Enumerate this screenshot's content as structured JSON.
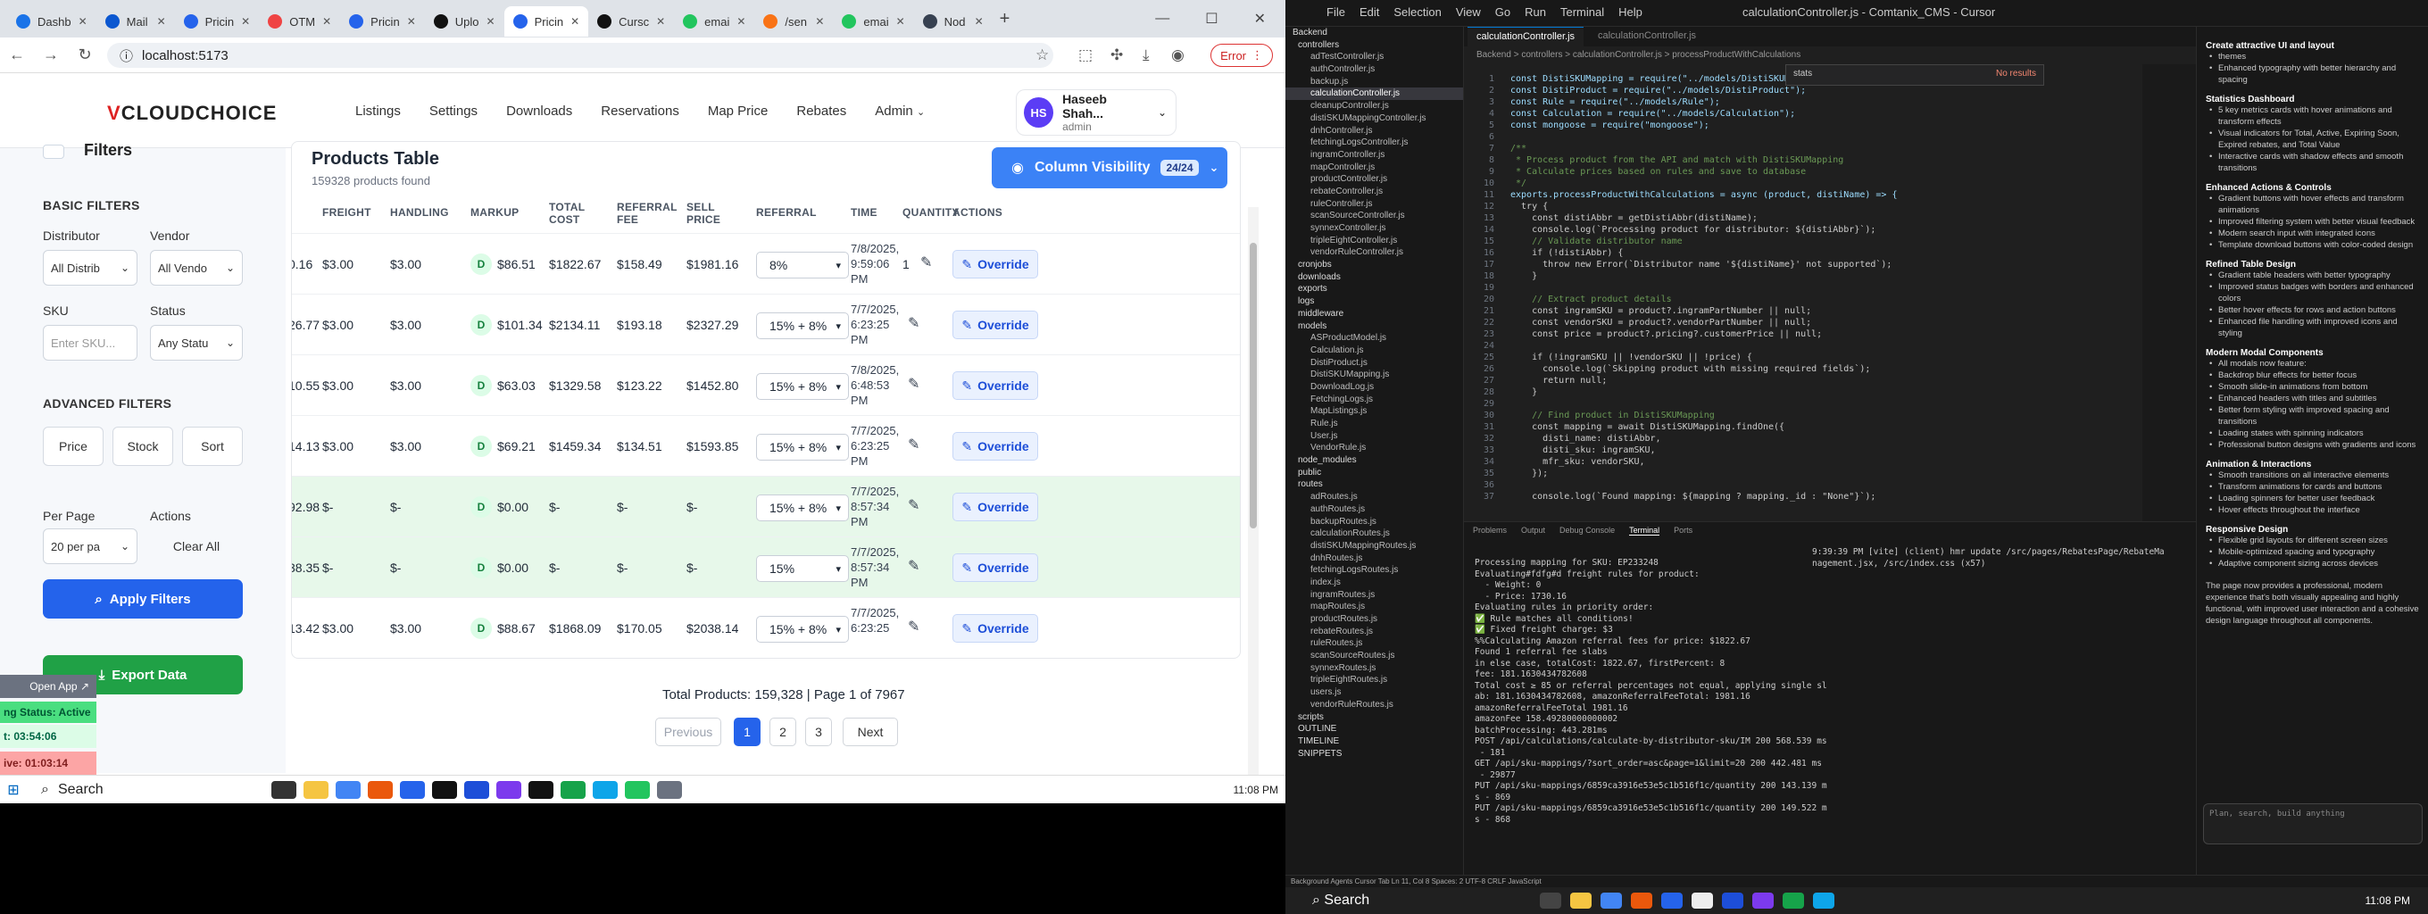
{
  "browser": {
    "tabs": [
      {
        "label": "Dashb",
        "color": "#1a73e8"
      },
      {
        "label": "Mail",
        "color": "#0b57d0"
      },
      {
        "label": "Pricin",
        "color": "#2563eb"
      },
      {
        "label": "OTM",
        "color": "#ef4444"
      },
      {
        "label": "Pricin",
        "color": "#2563eb"
      },
      {
        "label": "Uplo",
        "color": "#111111"
      },
      {
        "label": "Pricin",
        "color": "#2563eb"
      },
      {
        "label": "Cursc",
        "color": "#111111"
      },
      {
        "label": "emai",
        "color": "#22c55e"
      },
      {
        "label": "/sen",
        "color": "#f97316"
      },
      {
        "label": "emai",
        "color": "#22c55e"
      },
      {
        "label": "Nod",
        "color": "#374151"
      }
    ],
    "url": "localhost:5173",
    "error_label": "Error"
  },
  "header": {
    "logo_v": "V",
    "logo_rest": "CLOUDCHOICE",
    "menu": [
      "Listings",
      "Settings",
      "Downloads",
      "Reservations",
      "Map Price",
      "Rebates",
      "Admin"
    ],
    "user": {
      "initials": "HS",
      "name": "Haseeb Shah...",
      "role": "admin"
    }
  },
  "sidebar": {
    "title": "Filters",
    "basic": "BASIC FILTERS",
    "distributor_label": "Distributor",
    "distributor_value": "All Distrib",
    "vendor_label": "Vendor",
    "vendor_value": "All Vendo",
    "sku_label": "SKU",
    "sku_placeholder": "Enter SKU...",
    "status_label": "Status",
    "status_value": "Any Statu",
    "advanced": "ADVANCED FILTERS",
    "adv_buttons": [
      "Price",
      "Stock",
      "Sort"
    ],
    "per_page_label": "Per Page",
    "per_page_value": "20 per pa",
    "actions_label": "Actions",
    "clear_all": "Clear All",
    "apply": "Apply Filters",
    "export": "Export Data"
  },
  "overlay": {
    "open_app": "Open App",
    "status": "ng Status: Active",
    "timer1": "t: 03:54:06",
    "timer2": "ive: 01:03:14"
  },
  "table": {
    "title": "Products Table",
    "subtitle": "159328 products found",
    "column_visibility": "Column Visibility",
    "col_count": "24/24",
    "headers": [
      "FREIGHT",
      "HANDLING",
      "MARKUP",
      "TOTAL COST",
      "REFERRAL FEE",
      "SELL PRICE",
      "REFERRAL",
      "TIME",
      "QUANTITY",
      "ACTIONS"
    ],
    "rows": [
      {
        "partial": "0.16",
        "freight": "$3.00",
        "handling": "$3.00",
        "markup": "$86.51",
        "total": "$1822.67",
        "ref_fee": "$158.49",
        "sell": "$1981.16",
        "referral": "8%",
        "time": [
          "7/8/2025,",
          "9:59:06",
          "PM"
        ],
        "qty": "1",
        "green": false
      },
      {
        "partial": "26.77",
        "freight": "$3.00",
        "handling": "$3.00",
        "markup": "$101.34",
        "total": "$2134.11",
        "ref_fee": "$193.18",
        "sell": "$2327.29",
        "referral": "15% + 8%",
        "time": [
          "7/7/2025,",
          "6:23:25",
          "PM"
        ],
        "qty": "",
        "green": false
      },
      {
        "partial": "10.55",
        "freight": "$3.00",
        "handling": "$3.00",
        "markup": "$63.03",
        "total": "$1329.58",
        "ref_fee": "$123.22",
        "sell": "$1452.80",
        "referral": "15% + 8%",
        "time": [
          "7/8/2025,",
          "6:48:53",
          "PM"
        ],
        "qty": "",
        "green": false
      },
      {
        "partial": "14.13",
        "freight": "$3.00",
        "handling": "$3.00",
        "markup": "$69.21",
        "total": "$1459.34",
        "ref_fee": "$134.51",
        "sell": "$1593.85",
        "referral": "15% + 8%",
        "time": [
          "7/7/2025,",
          "6:23:25",
          "PM"
        ],
        "qty": "",
        "green": false
      },
      {
        "partial": "92.98",
        "freight": "$-",
        "handling": "$-",
        "markup": "$0.00",
        "total": "$-",
        "ref_fee": "$-",
        "sell": "$-",
        "referral": "15% + 8%",
        "time": [
          "7/7/2025,",
          "8:57:34",
          "PM"
        ],
        "qty": "",
        "green": true
      },
      {
        "partial": "38.35",
        "freight": "$-",
        "handling": "$-",
        "markup": "$0.00",
        "total": "$-",
        "ref_fee": "$-",
        "sell": "$-",
        "referral": "15%",
        "time": [
          "7/7/2025,",
          "8:57:34",
          "PM"
        ],
        "qty": "",
        "green": true
      },
      {
        "partial": "13.42",
        "freight": "$3.00",
        "handling": "$3.00",
        "markup": "$88.67",
        "total": "$1868.09",
        "ref_fee": "$170.05",
        "sell": "$2038.14",
        "referral": "15% + 8%",
        "time": [
          "7/7/2025,",
          "6:23:25",
          ""
        ],
        "qty": "",
        "green": false
      }
    ],
    "badge": "D",
    "override": "Override"
  },
  "pagination": {
    "total": "Total Products: 159,328 | Page 1 of 7967",
    "prev": "Previous",
    "pages": [
      "1",
      "2",
      "3"
    ],
    "next": "Next"
  },
  "taskbar": {
    "search": "Search",
    "clock": "11:08 PM"
  },
  "editor": {
    "menu": [
      "File",
      "Edit",
      "Selection",
      "View",
      "Go",
      "Run",
      "Terminal",
      "Help"
    ],
    "title": "calculationController.js - Comtanix_CMS - Cursor",
    "tab": "calculationController.js",
    "tab2": "calculationController.js",
    "breadcrumb": "Backend > controllers > calculationController.js > processProductWithCalculations",
    "find": "stats",
    "find_result": "No results",
    "explorer": [
      "Backend",
      "controllers",
      "adTestController.js",
      "authController.js",
      "backup.js",
      "calculationController.js",
      "cleanupController.js",
      "distiSKUMappingController.js",
      "dnhController.js",
      "fetchingLogsController.js",
      "ingramController.js",
      "mapController.js",
      "productController.js",
      "rebateController.js",
      "ruleController.js",
      "scanSourceController.js",
      "synnexController.js",
      "tripleEightController.js",
      "vendorRuleController.js",
      "cronjobs",
      "downloads",
      "exports",
      "logs",
      "middleware",
      "models",
      "ASProductModel.js",
      "Calculation.js",
      "DistiProduct.js",
      "DistiSKUMapping.js",
      "DownloadLog.js",
      "FetchingLogs.js",
      "MapListings.js",
      "Rule.js",
      "User.js",
      "VendorRule.js",
      "node_modules",
      "public",
      "routes",
      "adRoutes.js",
      "authRoutes.js",
      "backupRoutes.js",
      "calculationRoutes.js",
      "distiSKUMappingRoutes.js",
      "dnhRoutes.js",
      "fetchingLogsRoutes.js",
      "index.js",
      "ingramRoutes.js",
      "mapRoutes.js",
      "productRoutes.js",
      "rebateRoutes.js",
      "ruleRoutes.js",
      "scanSourceRoutes.js",
      "synnexRoutes.js",
      "tripleEightRoutes.js",
      "users.js",
      "vendorRuleRoutes.js",
      "scripts",
      "OUTLINE",
      "TIMELINE",
      "SNIPPETS"
    ],
    "code": [
      {
        "n": "1",
        "t": "const DistiSKUMapping = require(\"../models/DistiSKUMapping\");"
      },
      {
        "n": "2",
        "t": "const DistiProduct = require(\"../models/DistiProduct\");"
      },
      {
        "n": "3",
        "t": "const Rule = require(\"../models/Rule\");"
      },
      {
        "n": "4",
        "t": "const Calculation = require(\"../models/Calculation\");"
      },
      {
        "n": "5",
        "t": "const mongoose = require(\"mongoose\");"
      },
      {
        "n": "6",
        "t": ""
      },
      {
        "n": "7",
        "t": "/**"
      },
      {
        "n": "8",
        "t": " * Process product from the API and match with DistiSKUMapping"
      },
      {
        "n": "9",
        "t": " * Calculate prices based on rules and save to database"
      },
      {
        "n": "10",
        "t": " */"
      },
      {
        "n": "11",
        "t": "exports.processProductWithCalculations = async (product, distiName) => {"
      },
      {
        "n": "12",
        "t": "  try {"
      },
      {
        "n": "13",
        "t": "    const distiAbbr = getDistiAbbr(distiName);"
      },
      {
        "n": "14",
        "t": "    console.log(`Processing product for distributor: ${distiAbbr}`);"
      },
      {
        "n": "15",
        "t": "    // Validate distributor name"
      },
      {
        "n": "16",
        "t": "    if (!distiAbbr) {"
      },
      {
        "n": "17",
        "t": "      throw new Error(`Distributor name '${distiName}' not supported`);"
      },
      {
        "n": "18",
        "t": "    }"
      },
      {
        "n": "19",
        "t": ""
      },
      {
        "n": "20",
        "t": "    // Extract product details"
      },
      {
        "n": "21",
        "t": "    const ingramSKU = product?.ingramPartNumber || null;"
      },
      {
        "n": "22",
        "t": "    const vendorSKU = product?.vendorPartNumber || null;"
      },
      {
        "n": "23",
        "t": "    const price = product?.pricing?.customerPrice || null;"
      },
      {
        "n": "24",
        "t": ""
      },
      {
        "n": "25",
        "t": "    if (!ingramSKU || !vendorSKU || !price) {"
      },
      {
        "n": "26",
        "t": "      console.log(`Skipping product with missing required fields`);"
      },
      {
        "n": "27",
        "t": "      return null;"
      },
      {
        "n": "28",
        "t": "    }"
      },
      {
        "n": "29",
        "t": ""
      },
      {
        "n": "30",
        "t": "    // Find product in DistiSKUMapping"
      },
      {
        "n": "31",
        "t": "    const mapping = await DistiSKUMapping.findOne({"
      },
      {
        "n": "32",
        "t": "      disti_name: distiAbbr,"
      },
      {
        "n": "33",
        "t": "      disti_sku: ingramSKU,"
      },
      {
        "n": "34",
        "t": "      mfr_sku: vendorSKU,"
      },
      {
        "n": "35",
        "t": "    });"
      },
      {
        "n": "36",
        "t": ""
      },
      {
        "n": "37",
        "t": "    console.log(`Found mapping: ${mapping ? mapping._id : \"None\"}`);"
      }
    ],
    "panel_tabs": [
      "Problems",
      "Output",
      "Debug Console",
      "Terminal",
      "Ports"
    ],
    "terminal": [
      "Processing mapping for SKU: EP233248",
      "",
      "Evaluating#fdfg#d freight rules for product:",
      "  - Weight: 0",
      "  - Price: 1730.16",
      "",
      "Evaluating rules in priority order:",
      "✅ Rule matches all conditions!",
      "✅ Fixed freight charge: $3",
      "",
      "%%Calculating Amazon referral fees for price: $1822.67",
      "Found 1 referral fee slabs",
      "in else case, totalCost: 1822.67, firstPercent: 8",
      "fee: 181.1630434782608",
      "Total cost ≥ 85 or referral percentages not equal, applying single sl",
      "ab: 181.1630434782608, amazonReferralFeeTotal: 1981.16",
      "amazonReferralFeeTotal 1981.16",
      "amazonFee 158.49280000000002",
      "batchProcessing: 443.281ms",
      "POST /api/calculations/calculate-by-distributor-sku/IM 200 568.539 ms",
      " - 181",
      "GET /api/sku-mappings/?sort_order=asc&page=1&limit=20 200 442.481 ms",
      " - 29877",
      "PUT /api/sku-mappings/6859ca3916e53e5c1b516f1c/quantity 200 143.139 m",
      "s - 869",
      "PUT /api/sku-mappings/6859ca3916e53e5c1b516f1c/quantity 200 149.522 m",
      "s - 868"
    ],
    "terminal2": [
      "9:39:39 PM [vite] (client) hmr update /src/pages/RebatesPage/RebateMa",
      "nagement.jsx, /src/index.css (x57)"
    ],
    "status": "Background Agents   Cursor Tab   Ln 11, Col 8   Spaces: 2   UTF-8   CRLF   JavaScript"
  },
  "chat": {
    "sections": [
      {
        "h": "Create attractive UI and layout",
        "items": [
          "themes",
          "Enhanced typography with better hierarchy and spacing"
        ]
      },
      {
        "h": "Statistics Dashboard",
        "items": [
          "5 key metrics cards with hover animations and transform effects",
          "Visual indicators for Total, Active, Expiring Soon, Expired rebates, and Total Value",
          "Interactive cards with shadow effects and smooth transitions"
        ]
      },
      {
        "h": "Enhanced Actions & Controls",
        "items": [
          "Gradient buttons with hover effects and transform animations",
          "Improved filtering system with better visual feedback",
          "Modern search input with integrated icons",
          "Template download buttons with color-coded design"
        ]
      },
      {
        "h": "Refined Table Design",
        "items": [
          "Gradient table headers with better typography",
          "Improved status badges with borders and enhanced colors",
          "Better hover effects for rows and action buttons",
          "Enhanced file handling with improved icons and styling"
        ]
      },
      {
        "h": "Modern Modal Components",
        "items": [
          "All modals now feature:",
          "Backdrop blur effects for better focus",
          "Smooth slide-in animations from bottom",
          "Enhanced headers with titles and subtitles",
          "Better form styling with improved spacing and transitions",
          "Loading states with spinning indicators",
          "Professional button designs with gradients and icons"
        ]
      },
      {
        "h": "Animation & Interactions",
        "items": [
          "Smooth transitions on all interactive elements",
          "Transform animations for cards and buttons",
          "Loading spinners for better user feedback",
          "Hover effects throughout the interface"
        ]
      },
      {
        "h": "Responsive Design",
        "items": [
          "Flexible grid layouts for different screen sizes",
          "Mobile-optimized spacing and typography",
          "Adaptive component sizing across devices"
        ]
      }
    ],
    "summary": "The page now provides a professional, modern experience that's both visually appealing and highly functional, with improved user interaction and a cohesive design language throughout all components.",
    "input_placeholder": "Plan, search, build anything"
  },
  "rtaskbar": {
    "search": "Search",
    "clock": "11:08 PM"
  }
}
